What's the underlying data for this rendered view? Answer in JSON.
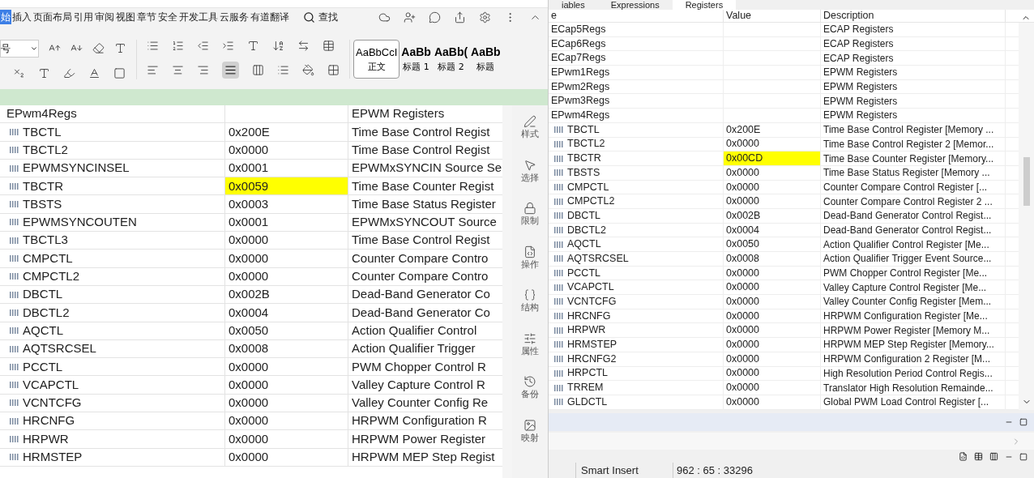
{
  "editor": {
    "menu_tabs": [
      {
        "label": "始",
        "selected": true
      },
      {
        "label": "插入",
        "selected": false
      },
      {
        "label": "页面布局",
        "selected": false
      },
      {
        "label": "引用",
        "selected": false
      },
      {
        "label": "审阅",
        "selected": false
      },
      {
        "label": "视图",
        "selected": false
      },
      {
        "label": "章节",
        "selected": false
      },
      {
        "label": "安全",
        "selected": false
      },
      {
        "label": "开发工具",
        "selected": false
      },
      {
        "label": "云服务",
        "selected": false
      },
      {
        "label": "有道翻译",
        "selected": false
      }
    ],
    "search_label": "查找",
    "font_size": "号",
    "styles": [
      {
        "preview": "AaBbCcI",
        "label": "正文",
        "selected": true
      },
      {
        "preview": "AaBb",
        "label": "标题 1",
        "selected": false
      },
      {
        "preview": "AaBb(",
        "label": "标题 2",
        "selected": false
      },
      {
        "preview": "AaBb",
        "label": "标题",
        "selected": false
      }
    ],
    "table": {
      "rows": [
        {
          "name": "EPwm4Regs",
          "value": "",
          "description": "EPWM Registers",
          "kind": "group",
          "changed": false
        },
        {
          "name": "TBCTL",
          "value": "0x200E",
          "description": "Time Base Control Regist",
          "kind": "register",
          "changed": false
        },
        {
          "name": "TBCTL2",
          "value": "0x0000",
          "description": "Time Base Control Regist",
          "kind": "register",
          "changed": false
        },
        {
          "name": "EPWMSYNCINSEL",
          "value": "0x0001",
          "description": "EPWMxSYNCIN Source Se",
          "kind": "register",
          "changed": false
        },
        {
          "name": "TBCTR",
          "value": "0x0059",
          "description": "Time Base Counter Regist",
          "kind": "register",
          "changed": true
        },
        {
          "name": "TBSTS",
          "value": "0x0003",
          "description": "Time Base Status Register",
          "kind": "register",
          "changed": false
        },
        {
          "name": "EPWMSYNCOUTEN",
          "value": "0x0001",
          "description": "EPWMxSYNCOUT Source",
          "kind": "register",
          "changed": false
        },
        {
          "name": "TBCTL3",
          "value": "0x0000",
          "description": "Time Base Control Regist",
          "kind": "register",
          "changed": false
        },
        {
          "name": "CMPCTL",
          "value": "0x0000",
          "description": "Counter Compare Contro",
          "kind": "register",
          "changed": false
        },
        {
          "name": "CMPCTL2",
          "value": "0x0000",
          "description": "Counter Compare Contro",
          "kind": "register",
          "changed": false
        },
        {
          "name": "DBCTL",
          "value": "0x002B",
          "description": "Dead-Band Generator Co",
          "kind": "register",
          "changed": false
        },
        {
          "name": "DBCTL2",
          "value": "0x0004",
          "description": "Dead-Band Generator Co",
          "kind": "register",
          "changed": false
        },
        {
          "name": "AQCTL",
          "value": "0x0050",
          "description": "Action Qualifier Control",
          "kind": "register",
          "changed": false
        },
        {
          "name": "AQTSRCSEL",
          "value": "0x0008",
          "description": "Action Qualifier Trigger",
          "kind": "register",
          "changed": false
        },
        {
          "name": "PCCTL",
          "value": "0x0000",
          "description": "PWM Chopper Control R",
          "kind": "register",
          "changed": false
        },
        {
          "name": "VCAPCTL",
          "value": "0x0000",
          "description": "Valley Capture Control R",
          "kind": "register",
          "changed": false
        },
        {
          "name": "VCNTCFG",
          "value": "0x0000",
          "description": "Valley Counter Config Re",
          "kind": "register",
          "changed": false
        },
        {
          "name": "HRCNFG",
          "value": "0x0000",
          "description": "HRPWM Configuration R",
          "kind": "register",
          "changed": false
        },
        {
          "name": "HRPWR",
          "value": "0x0000",
          "description": "HRPWM Power Register",
          "kind": "register",
          "changed": false
        },
        {
          "name": "HRMSTEP",
          "value": "0x0000",
          "description": "HRPWM MEP Step Regist",
          "kind": "register",
          "changed": false
        }
      ]
    },
    "side_tools": [
      {
        "label": "样式",
        "kind": "pen"
      },
      {
        "label": "选择",
        "kind": "pointer"
      },
      {
        "label": "限制",
        "kind": "lock"
      },
      {
        "label": "操作",
        "kind": "code"
      },
      {
        "label": "结构",
        "kind": "structure"
      },
      {
        "label": "属性",
        "kind": "sliders"
      },
      {
        "label": "备份",
        "kind": "history"
      },
      {
        "label": "映射",
        "kind": "map"
      }
    ]
  },
  "debugger": {
    "tabs": [
      {
        "label": "iables",
        "selected": false
      },
      {
        "label": "Expressions",
        "selected": false
      },
      {
        "label": "Registers",
        "selected": true
      }
    ],
    "columns": [
      "e",
      "Value",
      "Description"
    ],
    "rows": [
      {
        "name": "ECap5Regs",
        "value": "",
        "description": "ECAP Registers",
        "kind": "group",
        "changed": false
      },
      {
        "name": "ECap6Regs",
        "value": "",
        "description": "ECAP Registers",
        "kind": "group",
        "changed": false
      },
      {
        "name": "ECap7Regs",
        "value": "",
        "description": "ECAP Registers",
        "kind": "group",
        "changed": false
      },
      {
        "name": "EPwm1Regs",
        "value": "",
        "description": "EPWM Registers",
        "kind": "group",
        "changed": false
      },
      {
        "name": "EPwm2Regs",
        "value": "",
        "description": "EPWM Registers",
        "kind": "group",
        "changed": false
      },
      {
        "name": "EPwm3Regs",
        "value": "",
        "description": "EPWM Registers",
        "kind": "group",
        "changed": false
      },
      {
        "name": "EPwm4Regs",
        "value": "",
        "description": "EPWM Registers",
        "kind": "group",
        "changed": false
      },
      {
        "name": "TBCTL",
        "value": "0x200E",
        "description": "Time Base Control Register [Memory ...",
        "kind": "register",
        "changed": false
      },
      {
        "name": "TBCTL2",
        "value": "0x0000",
        "description": "Time Base Control Register 2 [Memor...",
        "kind": "register",
        "changed": false
      },
      {
        "name": "TBCTR",
        "value": "0x00CD",
        "description": "Time Base Counter Register [Memory...",
        "kind": "register",
        "changed": true
      },
      {
        "name": "TBSTS",
        "value": "0x0000",
        "description": "Time Base Status Register [Memory ...",
        "kind": "register",
        "changed": false
      },
      {
        "name": "CMPCTL",
        "value": "0x0000",
        "description": "Counter Compare Control Register [...",
        "kind": "register",
        "changed": false
      },
      {
        "name": "CMPCTL2",
        "value": "0x0000",
        "description": "Counter Compare Control Register 2 ...",
        "kind": "register",
        "changed": false
      },
      {
        "name": "DBCTL",
        "value": "0x002B",
        "description": "Dead-Band Generator Control Regist...",
        "kind": "register",
        "changed": false
      },
      {
        "name": "DBCTL2",
        "value": "0x0004",
        "description": "Dead-Band Generator Control Regist...",
        "kind": "register",
        "changed": false
      },
      {
        "name": "AQCTL",
        "value": "0x0050",
        "description": "Action Qualifier Control Register [Me...",
        "kind": "register",
        "changed": false
      },
      {
        "name": "AQTSRCSEL",
        "value": "0x0008",
        "description": "Action Qualifier Trigger Event Source...",
        "kind": "register",
        "changed": false
      },
      {
        "name": "PCCTL",
        "value": "0x0000",
        "description": "PWM Chopper Control Register [Me...",
        "kind": "register",
        "changed": false
      },
      {
        "name": "VCAPCTL",
        "value": "0x0000",
        "description": "Valley Capture Control Register [Me...",
        "kind": "register",
        "changed": false
      },
      {
        "name": "VCNTCFG",
        "value": "0x0000",
        "description": "Valley Counter Config Register [Mem...",
        "kind": "register",
        "changed": false
      },
      {
        "name": "HRCNFG",
        "value": "0x0000",
        "description": "HRPWM Configuration Register [Me...",
        "kind": "register",
        "changed": false
      },
      {
        "name": "HRPWR",
        "value": "0x0000",
        "description": "HRPWM Power Register [Memory M...",
        "kind": "register",
        "changed": false
      },
      {
        "name": "HRMSTEP",
        "value": "0x0000",
        "description": "HRPWM MEP Step Register [Memory...",
        "kind": "register",
        "changed": false
      },
      {
        "name": "HRCNFG2",
        "value": "0x0000",
        "description": "HRPWM Configuration 2 Register [M...",
        "kind": "register",
        "changed": false
      },
      {
        "name": "HRPCTL",
        "value": "0x0000",
        "description": "High Resolution Period Control Regis...",
        "kind": "register",
        "changed": false
      },
      {
        "name": "TRREM",
        "value": "0x0000",
        "description": "Translator High Resolution Remainde...",
        "kind": "register",
        "changed": false
      },
      {
        "name": "GLDCTL",
        "value": "0x0000",
        "description": "Global PWM Load Control Register [...",
        "kind": "register",
        "changed": false
      }
    ],
    "status": {
      "mode": "Smart Insert",
      "position": "962 : 65 : 33296"
    }
  }
}
